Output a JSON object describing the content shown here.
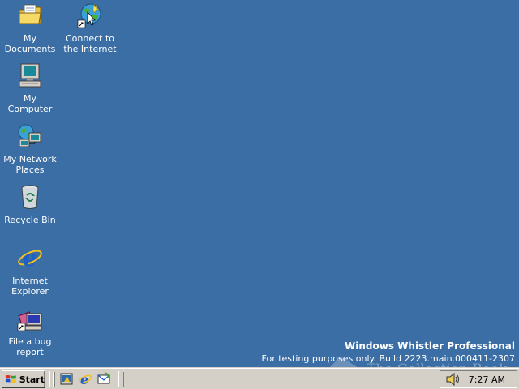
{
  "desktop": {
    "background": "#3a6ea5",
    "icons": [
      {
        "label": "My Documents",
        "icon": "folder-documents-icon"
      },
      {
        "label": "Connect to\nthe Internet",
        "icon": "connect-internet-icon"
      },
      {
        "label": "My Computer",
        "icon": "computer-icon"
      },
      {
        "label": "My Network\nPlaces",
        "icon": "network-places-icon"
      },
      {
        "label": "Recycle Bin",
        "icon": "recycle-bin-icon"
      },
      {
        "label": "Internet\nExplorer",
        "icon": "internet-explorer-icon"
      },
      {
        "label": "File a bug\nreport",
        "icon": "bug-report-icon"
      }
    ]
  },
  "watermark": {
    "title": "Windows Whistler Professional",
    "build": "For testing purposes only. Build 2223.main.000411-2307",
    "overlay": "The Collection Book"
  },
  "taskbar": {
    "start_label": "Start",
    "quick_launch": [
      "show-desktop-icon",
      "internet-explorer-icon",
      "outlook-express-icon"
    ],
    "tray": {
      "volume_icon": "speaker-icon",
      "clock": "7:27 AM"
    }
  }
}
